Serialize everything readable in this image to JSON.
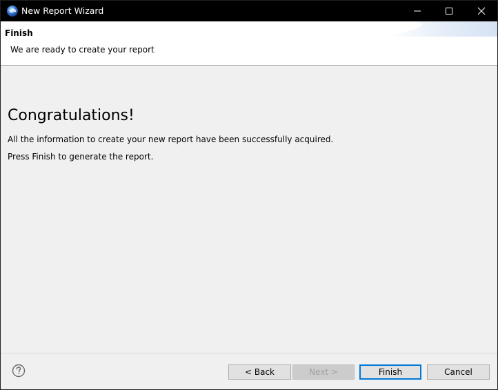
{
  "window": {
    "title": "New Report Wizard",
    "controls": {
      "minimize_glyph": "—",
      "maximize_glyph": "☐",
      "close_glyph": "✕"
    }
  },
  "header": {
    "title": "Finish",
    "description": "We are ready to create your report"
  },
  "content": {
    "heading": "Congratulations!",
    "line1": "All the information to create your new report have been successfully acquired.",
    "line2": "Press Finish to generate the report."
  },
  "footer": {
    "help_icon": "help-icon",
    "buttons": {
      "back": "< Back",
      "next": "Next >",
      "finish": "Finish",
      "cancel": "Cancel"
    }
  },
  "colors": {
    "titlebar": "#000000",
    "accent": "#0078d7",
    "panel": "#f0f0f0",
    "header": "#ffffff"
  }
}
